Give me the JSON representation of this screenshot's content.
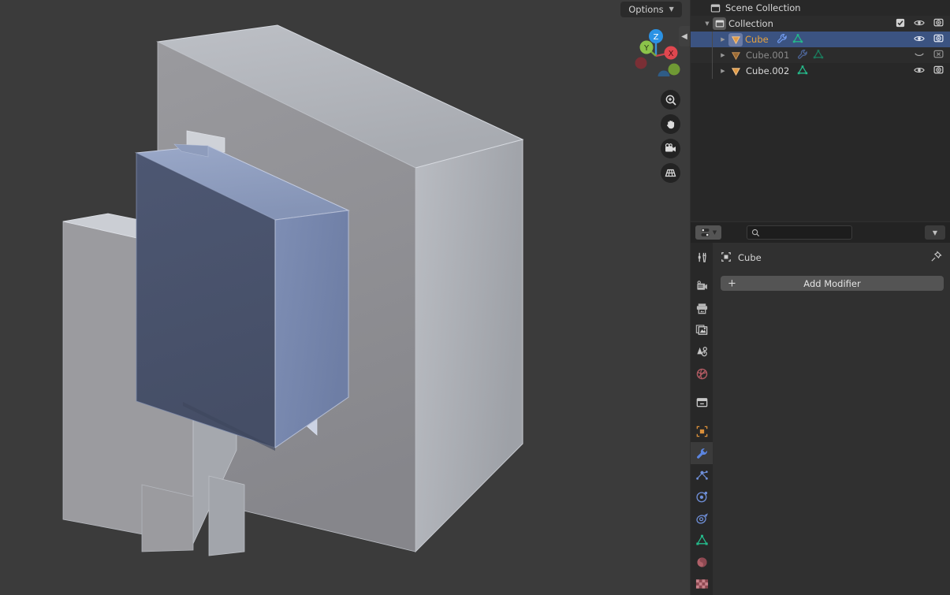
{
  "app": {
    "name": "Blender",
    "theme": "dark"
  },
  "viewport": {
    "name": "3d-viewport",
    "background_color": "#3b3b3b",
    "options_button": {
      "label": "Options",
      "chevron": "chevron-down-icon"
    },
    "collapse_arrow": "chevron-left-icon",
    "gizmo": {
      "name": "navigation-gizmo",
      "axes": [
        {
          "label": "X",
          "color": "#e0474f",
          "kind": "positive"
        },
        {
          "label": "Y",
          "color": "#8bc34a",
          "kind": "positive"
        },
        {
          "label": "Z",
          "color": "#2b92e4",
          "kind": "positive"
        },
        {
          "label": "",
          "color": "#7a2f35",
          "kind": "negative-x"
        },
        {
          "label": "",
          "color": "#8bc34a",
          "kind": "negative-y"
        },
        {
          "label": "",
          "color": "#2f5c86",
          "kind": "negative-z"
        }
      ]
    },
    "tools": [
      {
        "icon": "zoom-icon",
        "label": "Zoom"
      },
      {
        "icon": "hand-icon",
        "label": "Move View"
      },
      {
        "icon": "camera-icon",
        "label": "Camera View"
      },
      {
        "icon": "grid-icon",
        "label": "Toggle Orthographic"
      }
    ],
    "objects": {
      "selected_color": "#8294b8",
      "unselected_color": "#a9a9a9",
      "selected_object": "Cube"
    }
  },
  "outliner": {
    "name": "outliner",
    "rows": [
      {
        "label": "Scene Collection",
        "icon": "scene-collection-icon",
        "depth": 0,
        "disclosure": "none",
        "selected": false,
        "label_color": "normal",
        "datalinks": [],
        "right_icons": []
      },
      {
        "label": "Collection",
        "icon": "collection-icon",
        "depth": 1,
        "disclosure": "open",
        "selected": false,
        "label_color": "normal",
        "datalinks": [],
        "right_icons": [
          "checkbox-checked-icon",
          "eye-open-icon",
          "camera-on-icon"
        ]
      },
      {
        "label": "Cube",
        "icon": "mesh-object-icon",
        "depth": 2,
        "disclosure": "closed",
        "selected": true,
        "label_color": "orange",
        "datalinks": [
          "modifier-wrench-icon",
          "mesh-data-icon"
        ],
        "right_icons": [
          "eye-open-icon",
          "camera-on-icon"
        ]
      },
      {
        "label": "Cube.001",
        "icon": "mesh-object-icon",
        "depth": 2,
        "disclosure": "closed",
        "selected": false,
        "label_color": "dim",
        "datalinks": [
          "modifier-wrench-icon",
          "mesh-data-icon"
        ],
        "right_icons": [
          "eye-closed-icon",
          "camera-off-icon"
        ]
      },
      {
        "label": "Cube.002",
        "icon": "mesh-object-icon",
        "depth": 2,
        "disclosure": "closed",
        "selected": false,
        "label_color": "normal",
        "datalinks": [
          "mesh-data-icon"
        ],
        "right_icons": [
          "eye-open-icon",
          "camera-on-icon"
        ]
      }
    ]
  },
  "properties": {
    "name": "properties-editor",
    "header": {
      "editor_type_icon": "editor-type-icon",
      "editor_type_chevron": "chevron-down-icon",
      "search": {
        "placeholder": "",
        "value": "",
        "icon": "search-icon"
      },
      "filter_chevron": "chevron-down-icon"
    },
    "tabs": [
      {
        "name": "tool",
        "icon": "tool-icon",
        "active": false,
        "group": 0
      },
      {
        "name": "render",
        "icon": "render-camera-icon",
        "active": false,
        "group": 1
      },
      {
        "name": "output",
        "icon": "output-printer-icon",
        "active": false,
        "group": 1
      },
      {
        "name": "view-layer",
        "icon": "view-layer-images-icon",
        "active": false,
        "group": 1
      },
      {
        "name": "scene",
        "icon": "scene-cone-icon",
        "active": false,
        "group": 1
      },
      {
        "name": "world",
        "icon": "world-globe-icon",
        "active": false,
        "group": 1
      },
      {
        "name": "collection",
        "icon": "collection-box-icon",
        "active": false,
        "group": 2
      },
      {
        "name": "object",
        "icon": "object-square-icon",
        "active": false,
        "group": 3
      },
      {
        "name": "modifiers",
        "icon": "wrench-icon",
        "active": true,
        "group": 3
      },
      {
        "name": "particles",
        "icon": "particles-icon",
        "active": false,
        "group": 3
      },
      {
        "name": "physics",
        "icon": "physics-orbit-icon",
        "active": false,
        "group": 3
      },
      {
        "name": "object-constraints",
        "icon": "constraints-icon",
        "active": false,
        "group": 3
      },
      {
        "name": "object-data",
        "icon": "mesh-data-triangle-icon",
        "active": false,
        "group": 3
      },
      {
        "name": "material",
        "icon": "material-sphere-icon",
        "active": false,
        "group": 3
      },
      {
        "name": "texture",
        "icon": "texture-checker-icon",
        "active": false,
        "group": 4
      }
    ],
    "breadcrumb": {
      "icon": "object-square-icon",
      "label": "Cube",
      "pin_icon": "pin-icon"
    },
    "add_modifier": {
      "label": "Add Modifier",
      "plus_icon": "plus-icon"
    }
  },
  "colors": {
    "window_bg": "#303030",
    "outliner_bg": "#282828",
    "selection_blue": "#3b5381",
    "object_orange": "#e8a33d",
    "mesh_green": "#25b98a",
    "modifier_blue": "#5b85e0",
    "button_grey": "#545454",
    "header_dark": "#232323"
  }
}
